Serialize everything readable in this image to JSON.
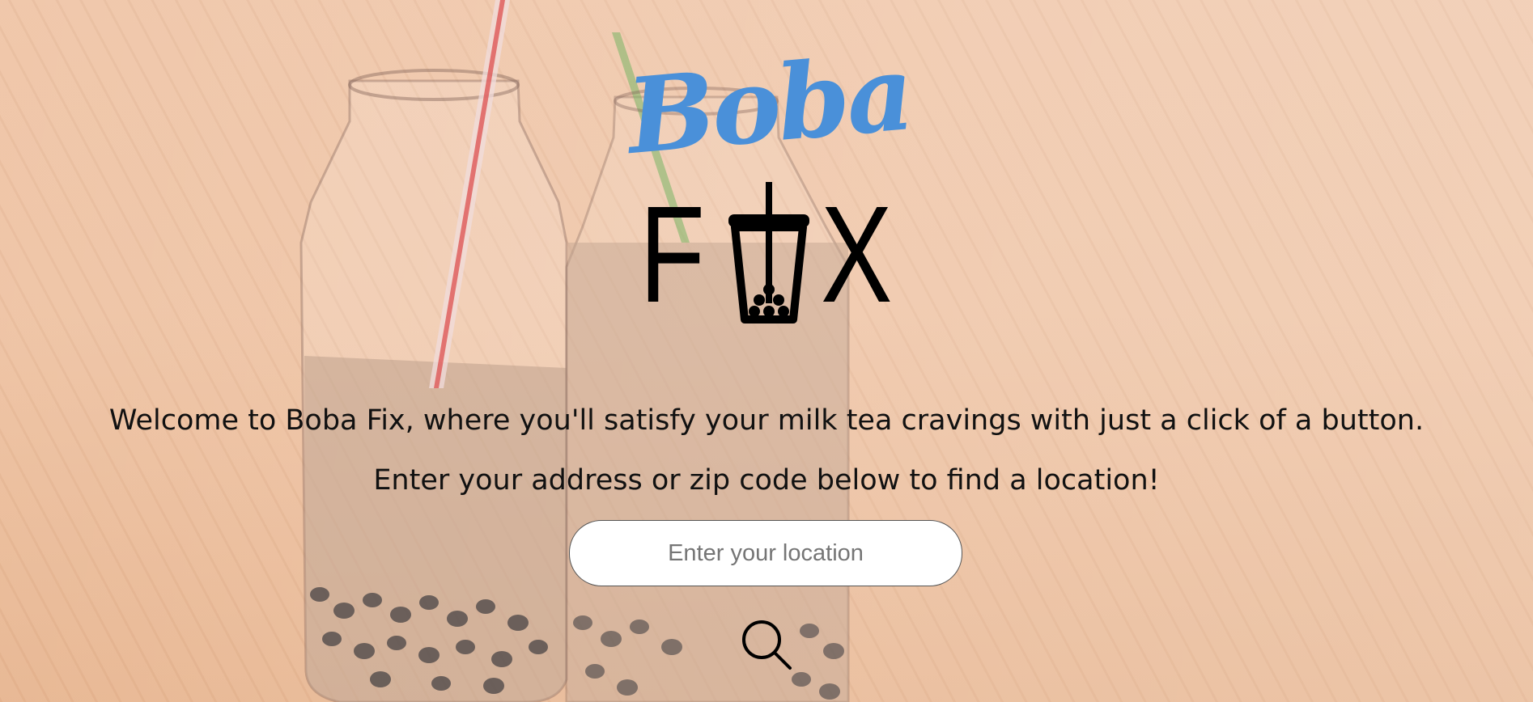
{
  "logo": {
    "script_text": "Boba",
    "fix_letter_1": "F",
    "fix_letter_3": "X",
    "script_color": "#4a90d9",
    "cup_icon": "boba-cup-icon"
  },
  "hero": {
    "welcome_text": "Welcome to Boba Fix, where you'll satisfy your milk tea cravings with just a click of a button.",
    "subtitle_text": "Enter your address or zip code below to find a location!"
  },
  "search": {
    "placeholder": "Enter your location",
    "value": "",
    "button_icon": "search-icon"
  },
  "colors": {
    "background": "#efc6a9",
    "text": "#111111",
    "input_background": "#ffffff"
  }
}
